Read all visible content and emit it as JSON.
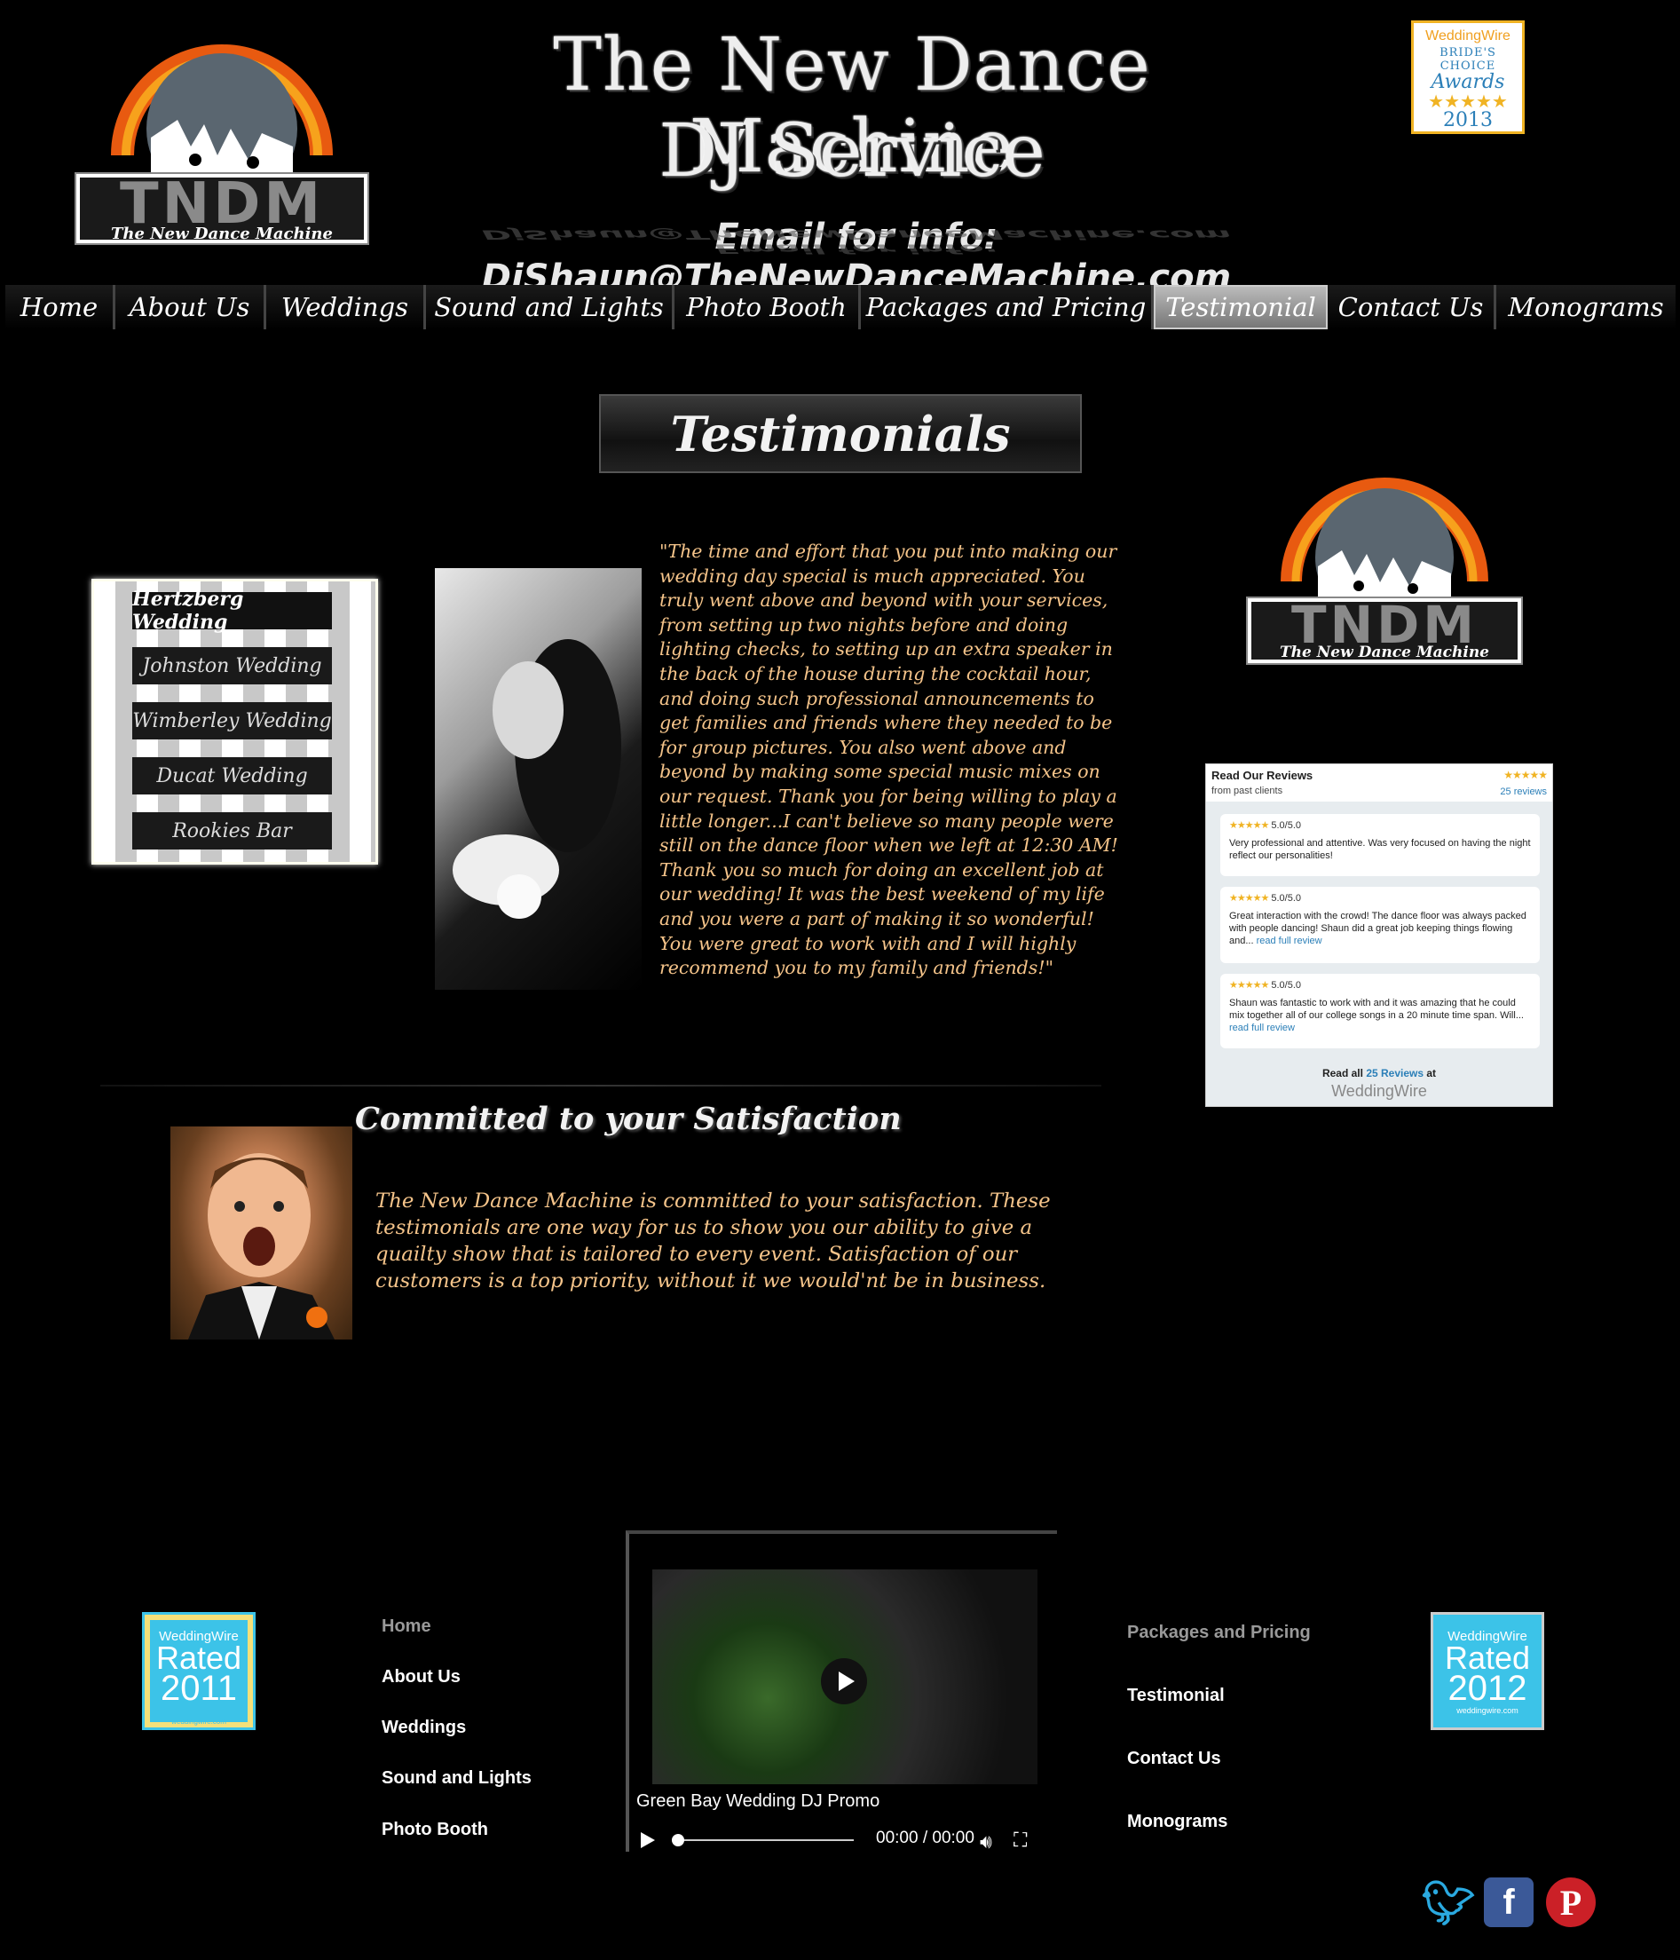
{
  "header": {
    "logo_text": "TNDM",
    "logo_tagline": "The New Dance Machine",
    "title_line1": "The New Dance Machine",
    "title_line2": "DJ Service",
    "email": "Email for info: DjShaun@TheNewDanceMachine.com",
    "award": {
      "brand": "WeddingWire",
      "line1": "BRIDE'S CHOICE",
      "line2": "Awards",
      "stars": "★★★★★",
      "year": "2013"
    }
  },
  "nav": {
    "items": [
      {
        "label": "Home"
      },
      {
        "label": "About Us"
      },
      {
        "label": "Weddings"
      },
      {
        "label": "Sound and Lights"
      },
      {
        "label": "Photo Booth"
      },
      {
        "label": "Packages and Pricing"
      },
      {
        "label": "Testimonial"
      },
      {
        "label": "Contact Us"
      },
      {
        "label": "Monograms"
      }
    ],
    "active": "Testimonial"
  },
  "main": {
    "heading": "Testimonials",
    "wedding_buttons": [
      {
        "label": "Hertzberg Wedding",
        "active": true
      },
      {
        "label": "Johnston Wedding"
      },
      {
        "label": "Wimberley Wedding"
      },
      {
        "label": "Ducat Wedding"
      },
      {
        "label": "Rookies Bar"
      }
    ],
    "quote": "\"The time and effort that you put into making our wedding day special is much appreciated.  You truly went above and beyond with your services, from setting up two nights before and doing lighting checks, to setting up an extra speaker in the back of the house during the cocktail hour, and doing such professional announcements to get families and friends where they needed to be for group pictures.  You also went above and beyond by making some special music mixes on our request.  Thank you for being willing to play a little longer...I can't believe so many people were still on the dance floor when we left at 12:30 AM!  Thank you so much for doing an excellent job at our wedding!  It was the best weekend of my life and you were a part of making it so wonderful!  You were great to work with and I will highly recommend you to my family and friends!\"",
    "committed_heading": "Committed to your Satisfaction",
    "committed_text": "The New Dance Machine is committed to your satisfaction.  These testimonials are one way for us to show you our ability to give a quailty show that is tailored to every event. Satisfaction of our customers is a top priority, without it we would'nt be in business."
  },
  "reviews_widget": {
    "title": "Read Our Reviews",
    "subtitle": "from past clients",
    "stars": "★★★★★",
    "count_link": "25 reviews",
    "reviews": [
      {
        "rating": "5.0/5.0",
        "text": "Very professional and attentive. Was very focused on having the night reflect our personalities!",
        "link": ""
      },
      {
        "rating": "5.0/5.0",
        "text": "Great interaction with the crowd! The dance floor was always packed with people dancing! Shaun did a great job keeping things flowing and...",
        "link": "read full review"
      },
      {
        "rating": "5.0/5.0",
        "text": "Shaun was fantastic to work with and it was amazing that he could mix together all of our college songs in a 20 minute time span. Will...",
        "link": "read full review"
      }
    ],
    "footer_prefix": "Read all ",
    "footer_link": "25 Reviews",
    "footer_suffix": " at",
    "brand": "WeddingWire"
  },
  "footer": {
    "rated_left": {
      "brand": "WeddingWire",
      "label": "Rated",
      "year": "2011",
      "site": "weddingwire.com"
    },
    "rated_right": {
      "brand": "WeddingWire",
      "label": "Rated",
      "year": "2012",
      "site": "weddingwire.com"
    },
    "links_left": [
      "Home",
      "About Us",
      "Weddings",
      "Sound and Lights",
      "Photo Booth"
    ],
    "links_right": [
      "Packages and Pricing",
      "Testimonial",
      "Contact Us",
      "Monograms"
    ],
    "video": {
      "title": "Green Bay Wedding DJ Promo",
      "time": "00:00 / 00:00"
    },
    "social": [
      {
        "icon": "twitter-icon",
        "color": "#2aa9e0"
      },
      {
        "icon": "facebook-icon",
        "color": "#3b5998"
      },
      {
        "icon": "pinterest-icon",
        "color": "#cb2027"
      }
    ]
  }
}
